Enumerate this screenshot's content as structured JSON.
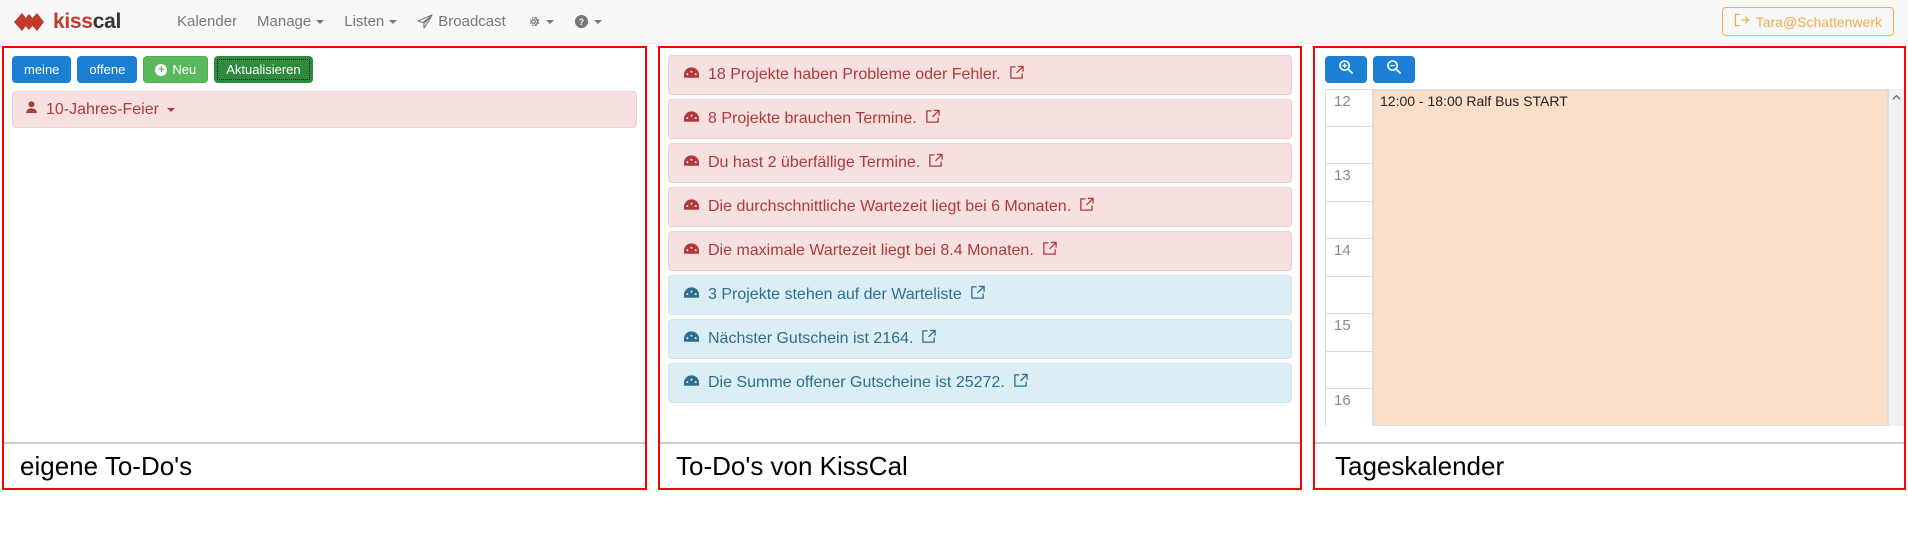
{
  "navbar": {
    "brand": "kisscal",
    "brand_part_1": "kiss",
    "brand_part_2": "cal",
    "links": [
      {
        "label": "Kalender",
        "has_caret": false,
        "icon": ""
      },
      {
        "label": "Manage",
        "has_caret": true,
        "icon": ""
      },
      {
        "label": "Listen",
        "has_caret": true,
        "icon": ""
      },
      {
        "label": "Broadcast",
        "has_caret": false,
        "icon": "paper-plane-icon"
      },
      {
        "label": "",
        "has_caret": true,
        "icon": "gear-icon"
      },
      {
        "label": "",
        "has_caret": true,
        "icon": "help-circle-icon"
      }
    ],
    "logout_label": "Tara@Schattenwerk",
    "logout_icon": "sign-out-icon",
    "accent_color": "#f0ad4e"
  },
  "left_panel": {
    "caption": "eigene To-Do's",
    "buttons": [
      {
        "label": "meine",
        "style": "blue",
        "icon": ""
      },
      {
        "label": "offene",
        "style": "blue",
        "icon": ""
      },
      {
        "label": "Neu",
        "style": "green",
        "icon": "plus-circle-icon"
      },
      {
        "label": "Aktualisieren",
        "style": "dark-green",
        "icon": ""
      }
    ],
    "items": [
      {
        "label": "10-Jahres-Feier",
        "icon": "user-icon",
        "has_caret": true
      }
    ]
  },
  "center_panel": {
    "caption": "To-Do's von KissCal",
    "alerts": [
      {
        "text": "18 Projekte haben Probleme oder Fehler.",
        "type": "danger",
        "icon": "dashboard-icon",
        "link_icon": "external-link-icon"
      },
      {
        "text": "8 Projekte brauchen Termine.",
        "type": "danger",
        "icon": "dashboard-icon",
        "link_icon": "external-link-icon"
      },
      {
        "text": "Du hast 2 überfällige Termine.",
        "type": "danger",
        "icon": "dashboard-icon",
        "link_icon": "external-link-icon"
      },
      {
        "text": "Die durchschnittliche Wartezeit liegt bei 6 Monaten.",
        "type": "danger",
        "icon": "dashboard-icon",
        "link_icon": "external-link-icon"
      },
      {
        "text": "Die maximale Wartezeit liegt bei 8.4 Monaten.",
        "type": "danger",
        "icon": "dashboard-icon",
        "link_icon": "external-link-icon"
      },
      {
        "text": "3 Projekte stehen auf der Warteliste",
        "type": "info",
        "icon": "dashboard-icon",
        "link_icon": "external-link-icon"
      },
      {
        "text": "Nächster Gutschein ist 2164.",
        "type": "info",
        "icon": "dashboard-icon",
        "link_icon": "external-link-icon"
      },
      {
        "text": "Die Summe offener Gutscheine ist 25272.",
        "type": "info",
        "icon": "dashboard-icon",
        "link_icon": "external-link-icon"
      }
    ],
    "danger_color": "#b03a3a",
    "info_color": "#2e6e8e"
  },
  "right_panel": {
    "caption": "Tageskalender",
    "zoom_in_icon": "zoom-in-icon",
    "zoom_out_icon": "zoom-out-icon",
    "hours": [
      "12",
      "13",
      "14",
      "15",
      "16"
    ],
    "event": {
      "label": "12:00 - 18:00 Ralf Bus START",
      "start": "12:00",
      "end": "18:00",
      "title": "Ralf Bus START",
      "color": "#fbdfc9"
    },
    "scroll_up_icon": "chevron-up-icon"
  }
}
